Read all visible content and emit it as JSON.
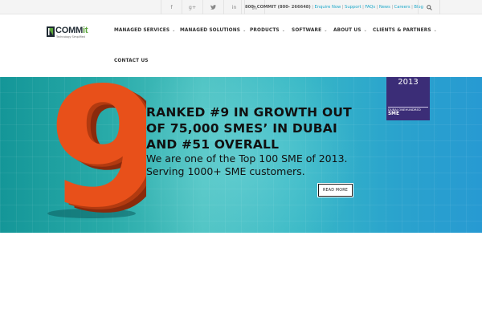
{
  "topbar": {
    "social": [
      {
        "icon": "facebook-icon",
        "glyph": "f"
      },
      {
        "icon": "google-plus-icon",
        "glyph": "g+"
      },
      {
        "icon": "twitter-icon",
        "glyph": "t"
      },
      {
        "icon": "linkedin-icon",
        "glyph": "in"
      },
      {
        "icon": "rss-icon",
        "glyph": "rss"
      }
    ],
    "phone": "800- COMMIT (800- 266648)",
    "links": [
      "Enquire Now",
      "Support",
      "FAQs",
      "News",
      "Careers",
      "Blog"
    ],
    "separator": "|",
    "search_icon": "search-icon"
  },
  "logo": {
    "word_main": "COMM",
    "word_accent": "it",
    "tagline": "Technology Simplified"
  },
  "nav": {
    "items": [
      {
        "label": "MANAGED SERVICES",
        "chevron": "⌄"
      },
      {
        "label": "MANAGED SOLUTIONS",
        "chevron": "⌄"
      },
      {
        "label": "PRODUCTS",
        "chevron": "⌄"
      },
      {
        "label": "SOFTWARE",
        "chevron": "⌄"
      },
      {
        "label": "ABOUT US",
        "chevron": "⌄"
      },
      {
        "label": "CLIENTS & PARTNERS",
        "chevron": "⌄"
      },
      {
        "label": "CONTACT US",
        "chevron": ""
      }
    ]
  },
  "hero": {
    "big_number": "9",
    "headline_lines": [
      "RANKED #9 IN GROWTH OUT",
      "OF 75,000 SMES’ IN DUBAI",
      "AND #51 OVERALL"
    ],
    "sub_lines": [
      "We are one of the Top 100 SME of 2013.",
      "Serving 1000+ SME customers."
    ],
    "read_more": "READ MORE",
    "badge": {
      "year": "2013",
      "line1": "DUBAI ONEHUNDRED",
      "line2": "SME"
    },
    "colors": {
      "number_face": "#e8501a",
      "badge_bg": "#3b2d77",
      "link": "#1da8c9"
    }
  }
}
